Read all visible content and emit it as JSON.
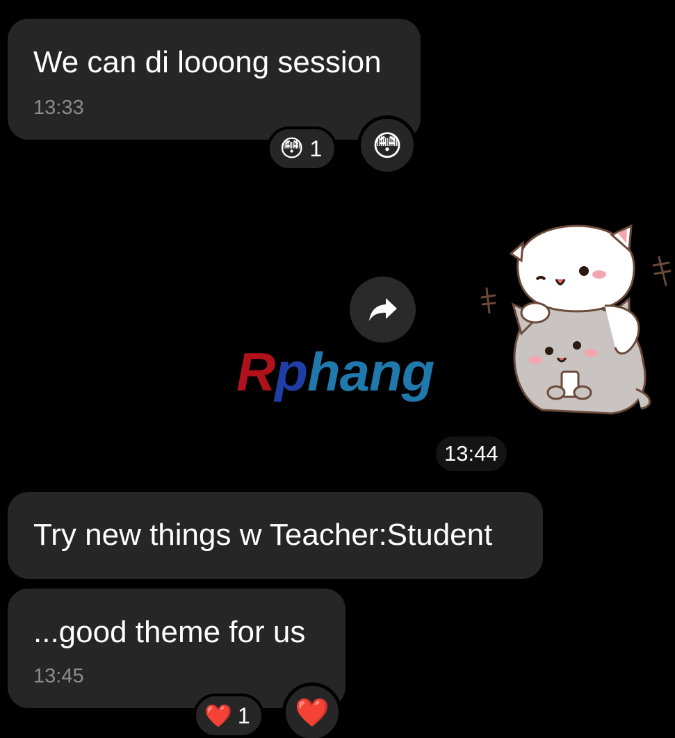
{
  "messages": [
    {
      "text": "We can di looong session",
      "time": "13:33",
      "reaction": {
        "emoji": "😳",
        "count": "1"
      }
    },
    {
      "text": "Try new things w Teacher:Student"
    },
    {
      "text": "...good theme for us",
      "time": "13:45",
      "reaction": {
        "emoji": "❤️",
        "count": "1"
      }
    }
  ],
  "sticker": {
    "time": "13:44",
    "forward_icon": "share-arrow-icon",
    "watermark": {
      "part_a": "R",
      "part_p": "p",
      "part_rest": "hang"
    }
  },
  "colors": {
    "bubble": "#262626",
    "background": "#000000",
    "timestamp": "#8d8d8d"
  }
}
